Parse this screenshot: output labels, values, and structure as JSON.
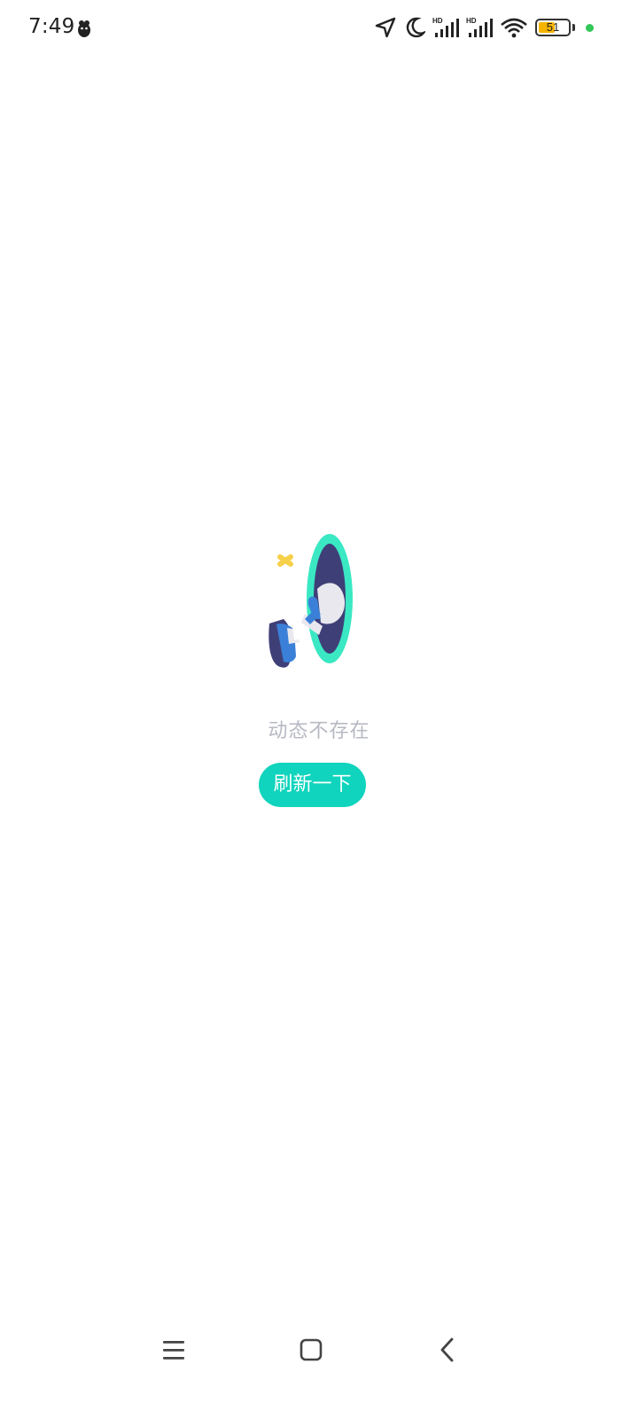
{
  "status_bar": {
    "time": "7:49",
    "battery_level": "51",
    "icons": [
      "location-icon",
      "moon-icon",
      "signal-hd-icon",
      "signal-hd-icon",
      "wifi-icon",
      "battery-icon",
      "active-dot"
    ]
  },
  "empty_state": {
    "message": "动态不存在",
    "button_label": "刷新一下"
  },
  "nav_bar": {
    "icons": [
      "menu-icon",
      "home-icon",
      "back-icon"
    ]
  },
  "colors": {
    "accent": "#10d4bd",
    "message_text": "#b7b9c3",
    "battery_fill": "#f4b400",
    "status_dot": "#34c759"
  }
}
